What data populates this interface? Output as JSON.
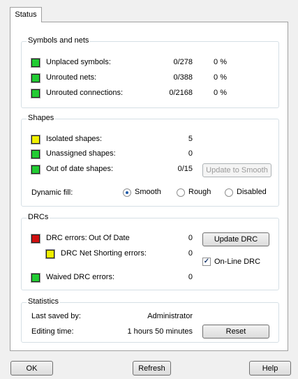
{
  "tab": {
    "label": "Status"
  },
  "symbols_nets": {
    "title": "Symbols and nets",
    "rows": [
      {
        "label": "Unplaced symbols:",
        "value": "0/278",
        "pct": "0 %",
        "swatch": "#22cc33"
      },
      {
        "label": "Unrouted nets:",
        "value": "0/388",
        "pct": "0 %",
        "swatch": "#22cc33"
      },
      {
        "label": "Unrouted connections:",
        "value": "0/2168",
        "pct": "0 %",
        "swatch": "#22cc33"
      }
    ]
  },
  "shapes": {
    "title": "Shapes",
    "rows": [
      {
        "label": "Isolated shapes:",
        "value": "5",
        "swatch": "#f0f000"
      },
      {
        "label": "Unassigned shapes:",
        "value": "0",
        "swatch": "#22cc33"
      },
      {
        "label": "Out of date shapes:",
        "value": "0/15",
        "swatch": "#22cc33"
      }
    ],
    "update_button": "Update to Smooth",
    "dynamic_fill_label": "Dynamic fill:",
    "fill_options": [
      "Smooth",
      "Rough",
      "Disabled"
    ],
    "fill_selected": "Smooth"
  },
  "drcs": {
    "title": "DRCs",
    "errors_label": "DRC errors:",
    "errors_status": "Out Of Date",
    "errors_value": "0",
    "errors_swatch": "#d01010",
    "net_short_label": "DRC Net Shorting errors:",
    "net_short_value": "0",
    "net_short_swatch": "#f0f000",
    "waived_label": "Waived DRC errors:",
    "waived_value": "0",
    "waived_swatch": "#22cc33",
    "update_button": "Update DRC",
    "online_label": "On-Line DRC",
    "online_checked": true
  },
  "statistics": {
    "title": "Statistics",
    "last_saved_label": "Last saved by:",
    "last_saved_value": "Administrator",
    "editing_label": "Editing time:",
    "editing_value": "1 hours 50 minutes",
    "reset_button": "Reset"
  },
  "footer": {
    "ok": "OK",
    "refresh": "Refresh",
    "help": "Help"
  }
}
